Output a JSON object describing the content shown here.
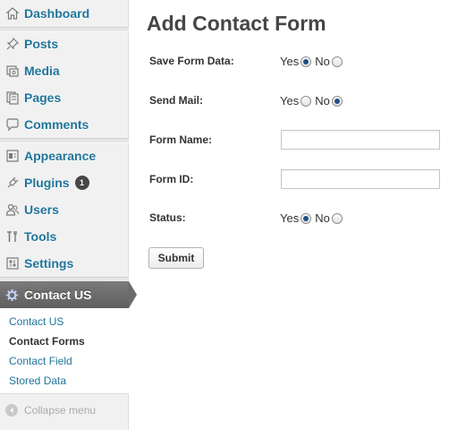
{
  "sidebar": {
    "items": [
      {
        "label": "Dashboard",
        "icon": "dashboard-icon"
      },
      {
        "label": "Posts",
        "icon": "pushpin-icon"
      },
      {
        "label": "Media",
        "icon": "media-icon"
      },
      {
        "label": "Pages",
        "icon": "pages-icon"
      },
      {
        "label": "Comments",
        "icon": "comment-icon"
      },
      {
        "label": "Appearance",
        "icon": "appearance-icon"
      },
      {
        "label": "Plugins",
        "icon": "plugin-icon",
        "badge": "1"
      },
      {
        "label": "Users",
        "icon": "users-icon"
      },
      {
        "label": "Tools",
        "icon": "tools-icon"
      },
      {
        "label": "Settings",
        "icon": "settings-icon"
      }
    ],
    "active": {
      "label": "Contact US",
      "icon": "gear-icon"
    },
    "submenu": [
      {
        "label": "Contact US",
        "current": false
      },
      {
        "label": "Contact Forms",
        "current": true
      },
      {
        "label": "Contact Field",
        "current": false
      },
      {
        "label": "Stored Data",
        "current": false
      }
    ],
    "collapse_label": "Collapse menu"
  },
  "main": {
    "title": "Add Contact Form",
    "form": {
      "save_form_data": {
        "label": "Save Form Data:",
        "yes": "Yes",
        "no": "No",
        "selected": "Yes"
      },
      "send_mail": {
        "label": "Send Mail:",
        "yes": "Yes",
        "no": "No",
        "selected": "No"
      },
      "form_name": {
        "label": "Form Name:",
        "value": ""
      },
      "form_id": {
        "label": "Form ID:",
        "value": ""
      },
      "status": {
        "label": "Status:",
        "yes": "Yes",
        "no": "No",
        "selected": "Yes"
      },
      "submit_label": "Submit"
    }
  },
  "colors": {
    "link": "#21759b",
    "active_menu": "#6a6a6a",
    "radio_selected": "#1f4f86"
  }
}
